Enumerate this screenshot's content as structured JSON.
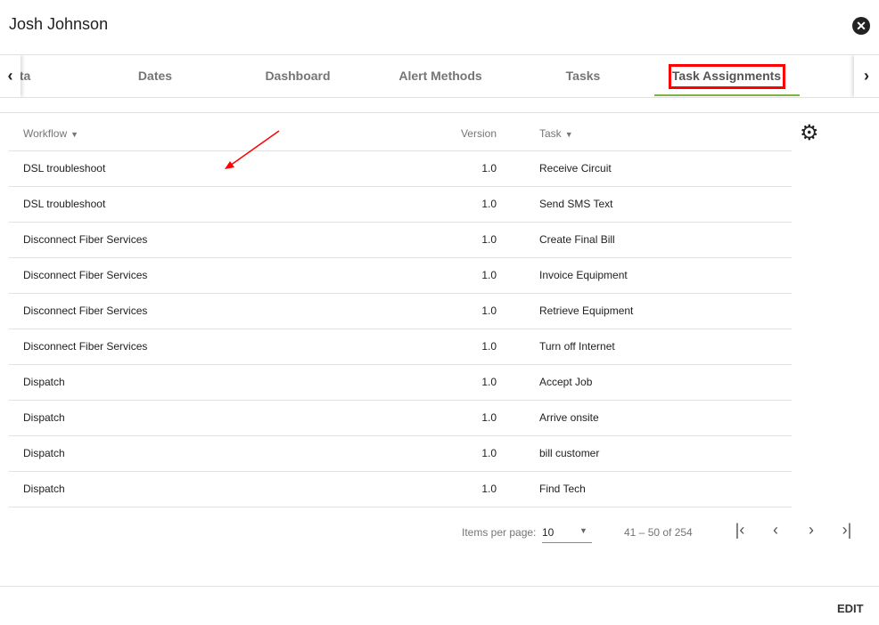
{
  "header": {
    "title": "Josh Johnson",
    "close_icon": "close-circle-icon"
  },
  "tabs": [
    {
      "label": "Data",
      "visible": "ta"
    },
    {
      "label": "Dates"
    },
    {
      "label": "Dashboard"
    },
    {
      "label": "Alert Methods"
    },
    {
      "label": "Tasks"
    },
    {
      "label": "Task Assignments",
      "active": true
    }
  ],
  "tab_accent": "#7cb342",
  "highlight_color": "#ff0000",
  "table": {
    "columns": {
      "workflow": "Workflow",
      "version": "Version",
      "task": "Task"
    },
    "rows": [
      {
        "workflow": "DSL troubleshoot",
        "version": "1.0",
        "task": "Receive Circuit"
      },
      {
        "workflow": "DSL troubleshoot",
        "version": "1.0",
        "task": "Send SMS Text"
      },
      {
        "workflow": "Disconnect Fiber Services",
        "version": "1.0",
        "task": "Create Final Bill"
      },
      {
        "workflow": "Disconnect Fiber Services",
        "version": "1.0",
        "task": "Invoice Equipment"
      },
      {
        "workflow": "Disconnect Fiber Services",
        "version": "1.0",
        "task": "Retrieve Equipment"
      },
      {
        "workflow": "Disconnect Fiber Services",
        "version": "1.0",
        "task": "Turn off Internet"
      },
      {
        "workflow": "Dispatch",
        "version": "1.0",
        "task": "Accept Job"
      },
      {
        "workflow": "Dispatch",
        "version": "1.0",
        "task": "Arrive onsite"
      },
      {
        "workflow": "Dispatch",
        "version": "1.0",
        "task": "bill customer"
      },
      {
        "workflow": "Dispatch",
        "version": "1.0",
        "task": "Find Tech"
      }
    ]
  },
  "paginator": {
    "items_per_page_label": "Items per page:",
    "items_per_page": "10",
    "range": "41 – 50 of 254"
  },
  "footer": {
    "edit_label": "EDIT"
  }
}
